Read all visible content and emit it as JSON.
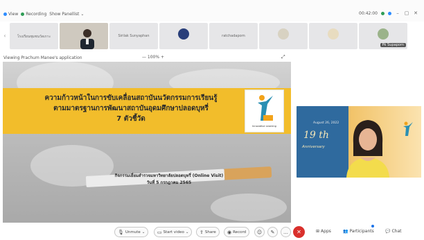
{
  "topbar": {
    "view_label": "View",
    "recording_label": "Recording",
    "host_label": "Show Panellist",
    "timer": "00:42:00"
  },
  "gallery": {
    "tiles": [
      {
        "name": "โรงเรียนชุมชนวัดเกาะ"
      },
      {
        "name": ""
      },
      {
        "name": "Sirilak Sunyaphan"
      },
      {
        "name": ""
      },
      {
        "name": "ratchadaporn"
      },
      {
        "name": ""
      },
      {
        "name": ""
      },
      {
        "name": "Pk Supaporn"
      }
    ]
  },
  "viewbar": {
    "label": "Viewing Prachum Manee's application",
    "zoom": "— 100% +"
  },
  "slide": {
    "title_line1": "ความก้าวหน้าในการขับเคลื่อนสถาบันนวัตกรรมการเรียนรู้",
    "title_line2": "ตามมาตรฐานการพัฒนาสถาบันอุดมศึกษาปลอดบุหรี่",
    "title_line3": "7 ตัวชี้วัด",
    "sub_line1": "กิจกรรมเยี่ยมสำรวจมหาวิทยาลัยปลอดบุหรี่ (Online Visit)",
    "sub_line2": "วันที่ 5 กรกฎาคม 2565",
    "logo_caption": "Innovative Learning"
  },
  "speaker": {
    "anniv_number": "19 th",
    "anniv_word": "Anniversary",
    "date_text": "August 26, 2022"
  },
  "toolbar": {
    "mute": "Unmute",
    "video": "Start video",
    "share": "Share",
    "record": "Record",
    "apps": "Apps",
    "participants": "Participants",
    "chat": "Chat",
    "leave_icon": "✕"
  },
  "colors": {
    "band": "#f2bd2b",
    "hangup": "#d9302c",
    "anniversary_blue": "#2f6a9e"
  }
}
